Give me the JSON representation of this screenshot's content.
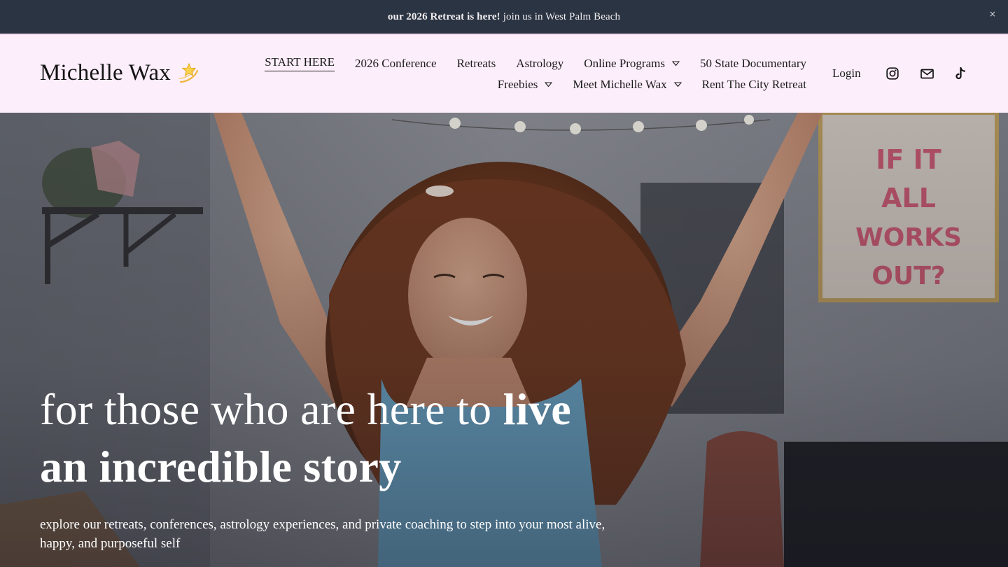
{
  "announcement": {
    "bold_text": "our 2026 Retreat is here!",
    "text": "join us in West Palm Beach",
    "close_glyph": "×"
  },
  "header": {
    "brand_name": "Michelle Wax",
    "brand_icon": "dizzy-star-icon",
    "nav_row_1": [
      {
        "label": "START HERE",
        "active": true,
        "dropdown": false
      },
      {
        "label": "2026 Conference",
        "dropdown": false
      },
      {
        "label": "Retreats",
        "dropdown": false
      },
      {
        "label": "Astrology",
        "dropdown": false
      },
      {
        "label": "Online Programs",
        "dropdown": true
      },
      {
        "label": "50 State Documentary",
        "dropdown": false
      }
    ],
    "nav_row_2": [
      {
        "label": "Freebies",
        "dropdown": true
      },
      {
        "label": "Meet Michelle Wax",
        "dropdown": true
      },
      {
        "label": "Rent The City Retreat",
        "dropdown": false
      }
    ],
    "login_label": "Login",
    "social_icons": [
      "instagram-icon",
      "email-icon",
      "tiktok-icon"
    ]
  },
  "hero": {
    "headline_regular": "for those who are here to ",
    "headline_bold_1": "live",
    "headline_bold_2": "an incredible story",
    "subtext": "explore our retreats, conferences, astrology experiences, and private coaching to step into your most alive, happy, and purposeful self",
    "background_sign_text": "WHAT IF IT ALL WORKS OUT?"
  },
  "colors": {
    "announcement_bg": "#2a3443",
    "header_bg": "#fdeefb",
    "text_dark": "#1a1a1a",
    "hero_text": "#ffffff"
  }
}
